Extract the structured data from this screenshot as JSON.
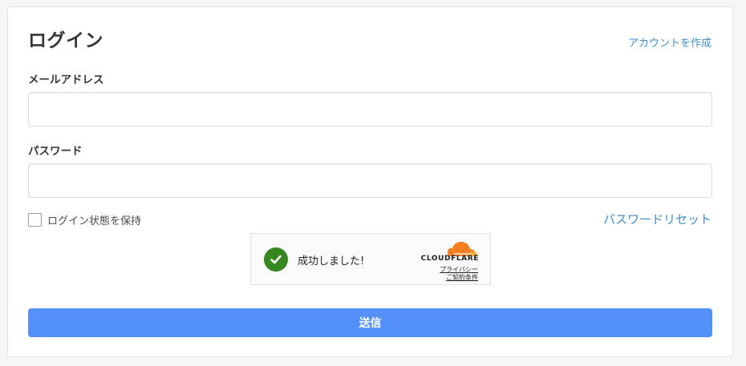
{
  "login": {
    "title": "ログイン",
    "create_account_link": "アカウントを作成",
    "email": {
      "label": "メールアドレス",
      "value": "",
      "placeholder": ""
    },
    "password": {
      "label": "パスワード",
      "value": "",
      "placeholder": ""
    },
    "remember_me": {
      "label": "ログイン状態を保持",
      "checked": false
    },
    "reset_password_link": "パスワードリセット",
    "submit_label": "送信"
  },
  "turnstile": {
    "status": "成功しました!",
    "brand": "CLOUDFLARE",
    "privacy_link": "プライバシー",
    "terms_link": "ご契約条件",
    "success_color": "#35871e",
    "cloud_colors": [
      "#f38020",
      "#faad3f"
    ]
  },
  "theme": {
    "link_color": "#3e8ed0",
    "button_color": "#5391f8"
  }
}
